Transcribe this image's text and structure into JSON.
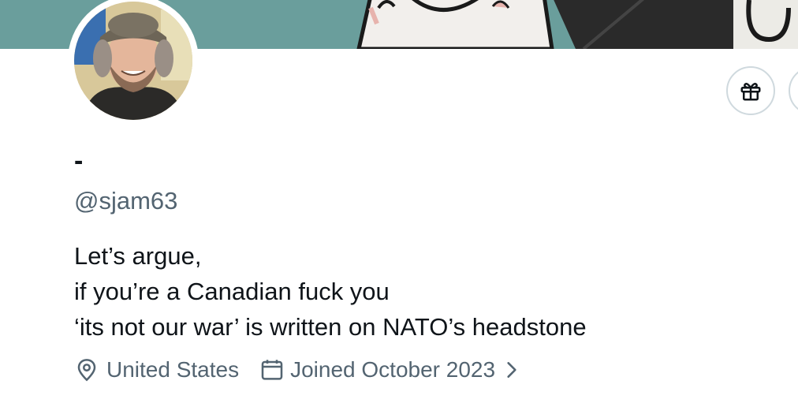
{
  "profile": {
    "display_name": "-",
    "handle": "@sjam63",
    "bio_lines": [
      "Let’s argue,",
      "if you’re a Canadian fuck you",
      "‘its not our war’ is written on NATO’s headstone"
    ],
    "location": "United States",
    "joined": "Joined October 2023"
  },
  "icons": {
    "gift_button": "gift-icon",
    "location": "location-pin-icon",
    "calendar": "calendar-icon",
    "joined_chevron": "chevron-right-icon"
  },
  "colors": {
    "banner": "#6a9e9c",
    "secondary_text": "#536471",
    "border": "#cfd9de"
  }
}
